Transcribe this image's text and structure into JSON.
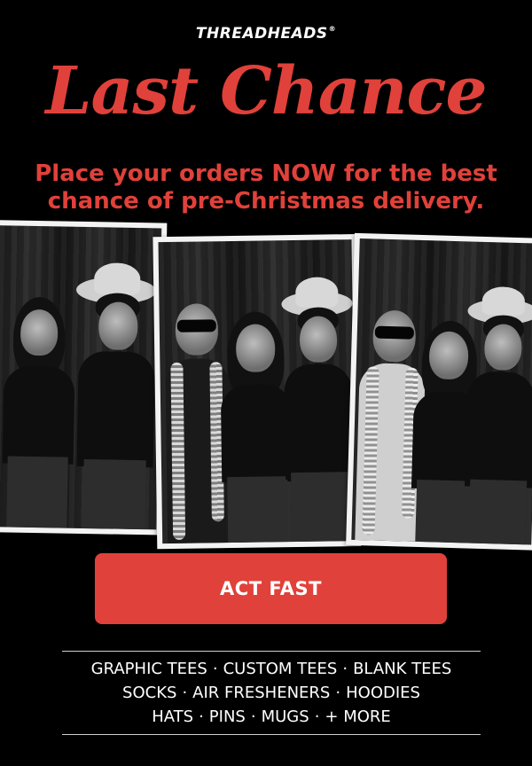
{
  "brand": {
    "logo_text": "THREADHEADS",
    "trademark": "®"
  },
  "hero": {
    "headline": "Last Chance",
    "subhead_line1": "Place your orders NOW for the best",
    "subhead_line2": "chance of pre-Christmas delivery."
  },
  "cta": {
    "label": "ACT FAST"
  },
  "categories": {
    "row1": [
      "GRAPHIC TEES",
      "CUSTOM TEES",
      "BLANK TEES"
    ],
    "row2": [
      "SOCKS",
      "AIR FRESHENERS",
      "HOODIES"
    ],
    "row3": [
      "HATS",
      "PINS",
      "MUGS",
      "+ MORE"
    ],
    "separator": "·"
  },
  "colors": {
    "background": "#000000",
    "accent_red": "#e0413a",
    "text_white": "#ffffff"
  }
}
